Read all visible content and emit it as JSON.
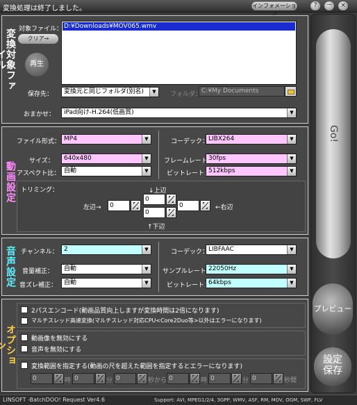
{
  "window": {
    "title": "変換処理は終了しました。",
    "info_button": "インフォメーション",
    "help_button": "?",
    "minimize_button": "－",
    "close_button": "×"
  },
  "source_section": {
    "title": "変換対象ファイル",
    "target_file_label": "対象ファイル：",
    "clear_button": "クリア→",
    "play_button": "再生",
    "files": [
      "D:¥Downloads¥MOV065.wmv"
    ],
    "save_to_label": "保存先：",
    "save_to_value": "変換元と同じフォルダ(別名)",
    "folder_label": "フォルダ：",
    "folder_value": "C:¥My Documents",
    "auto_label": "おまかせ：",
    "auto_value": "iPad向け-H.264(低画質)"
  },
  "video_section": {
    "title": "動画設定",
    "file_format_label": "ファイル形式：",
    "file_format_value": "MP4",
    "size_label": "サイズ：",
    "size_value": "640x480",
    "aspect_label": "アスペクト比：",
    "aspect_value": "自動",
    "codec_label": "コーデック：",
    "codec_value": "LIBX264",
    "framerate_label": "フレームレート：",
    "framerate_value": "30fps",
    "bitrate_label": "ビットレート：",
    "bitrate_value": "512kbps",
    "trimming_label": "トリミング：",
    "top_label": "↓上辺",
    "left_label": "左辺→",
    "right_label": "←右辺",
    "bottom_label": "↑下辺",
    "top_value": "0",
    "left_value": "0",
    "right_value": "0",
    "bottom_value": "0"
  },
  "audio_section": {
    "title": "音声設定",
    "channel_label": "チャンネル：",
    "channel_value": "2",
    "volume_label": "音量補正：",
    "volume_value": "自動",
    "delay_label": "音ズレ補正：",
    "delay_value": "自動",
    "codec_label": "コーデック：",
    "codec_value": "LIBFAAC",
    "samplerate_label": "サンプルレート：",
    "samplerate_value": "22050Hz",
    "bitrate_label": "ビットレート：",
    "bitrate_value": "64kbps"
  },
  "options_section": {
    "title": "オプション",
    "option1": "2パスエンコード(動画品質向上しますが変換時間は2倍になります)",
    "option2": "マルチスレッド高速変換(マルチスレッド対応CPU<Core2Duo等>以外はエラーになります)",
    "option3": "動画像を無効にする",
    "option4": "音声を無効にする",
    "option5": "変換範囲を指定する(動画の尺を超えた範囲を指定するとエラーになります)",
    "range_values": [
      "0",
      "0",
      "0",
      "0",
      "0",
      "0"
    ],
    "range_units": [
      "時",
      "分",
      "秒から",
      "時",
      "分",
      "秒間"
    ]
  },
  "side_buttons": {
    "go": "Go!",
    "preview": "プレビュー",
    "save_settings": "設定保存"
  },
  "status_bar": {
    "left": "LINSOFT -BatchDOO! Request Ver4.6",
    "right": "Support: AVI, MPEG1/2/4, 3GPP, WMV, ASF, RM, MOV, OGM, SWF, FLV"
  }
}
